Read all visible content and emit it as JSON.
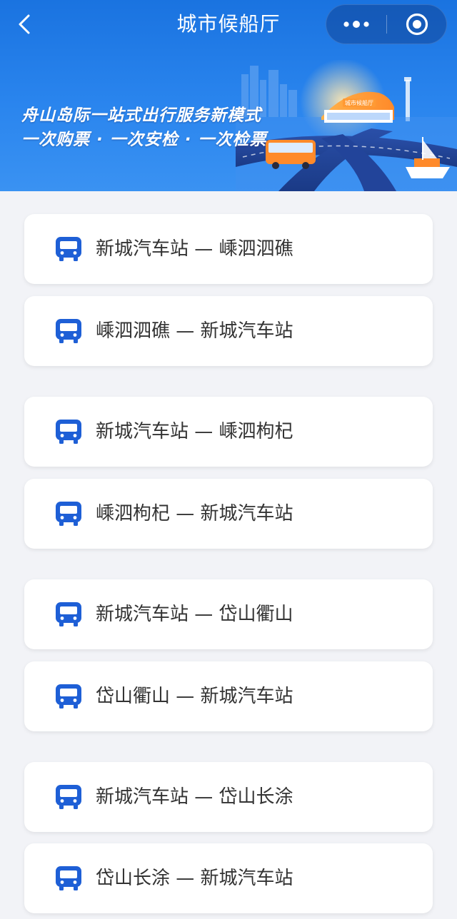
{
  "nav": {
    "title": "城市候船厅",
    "back_icon": "chevron-left-icon",
    "more_icon": "more-dots-icon",
    "close_icon": "target-close-icon"
  },
  "banner": {
    "line1": "舟山岛际一站式出行服务新模式",
    "line2": "一次购票 · 一次安检 · 一次检票",
    "sign_text": "城市候船厅"
  },
  "colors": {
    "header_blue": "#1a73e0",
    "bus_icon_blue": "#1e5fd6",
    "page_bg": "#f2f3f7"
  },
  "routes": [
    {
      "label": "新城汽车站 — 嵊泗泗礁",
      "icon": "bus-icon"
    },
    {
      "label": "嵊泗泗礁 — 新城汽车站",
      "icon": "bus-icon"
    },
    {
      "label": "新城汽车站 — 嵊泗枸杞",
      "icon": "bus-icon"
    },
    {
      "label": "嵊泗枸杞 — 新城汽车站",
      "icon": "bus-icon"
    },
    {
      "label": "新城汽车站 — 岱山衢山",
      "icon": "bus-icon"
    },
    {
      "label": "岱山衢山 — 新城汽车站",
      "icon": "bus-icon"
    },
    {
      "label": "新城汽车站 — 岱山长涂",
      "icon": "bus-icon"
    },
    {
      "label": "岱山长涂 — 新城汽车站",
      "icon": "bus-icon"
    }
  ]
}
